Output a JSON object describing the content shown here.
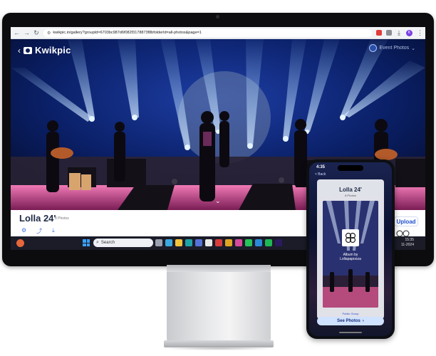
{
  "browser": {
    "url": "kwikpic.in/gallery?groupId=6703bc987d6f082f3178873f8bfolderId=all-photos&page=1",
    "back_glyph": "←",
    "forward_glyph": "→",
    "reload_glyph": "↻",
    "profile_initial": "K"
  },
  "header": {
    "brand": "Kwikpic",
    "user_name": "Event Photos",
    "back_icon": "arrow-left-icon"
  },
  "album": {
    "title": "Lolla 24'",
    "count": "8 Photos",
    "upload_label": "Upload",
    "icons": [
      "settings-icon",
      "share-icon",
      "download-icon"
    ]
  },
  "taskbar": {
    "search_placeholder": "Search",
    "time": "15:35",
    "date": "11-2024"
  },
  "phone": {
    "status_time": "4:35",
    "back_label": "< Back",
    "album_title": "Lolla 24'",
    "album_count": "8 Photos",
    "album_by_line1": "Album by",
    "album_by_line2": "Lollapapooza",
    "public_label": "Public Group",
    "see_photos_label": "See Photos",
    "see_photos_arrow": "›"
  }
}
